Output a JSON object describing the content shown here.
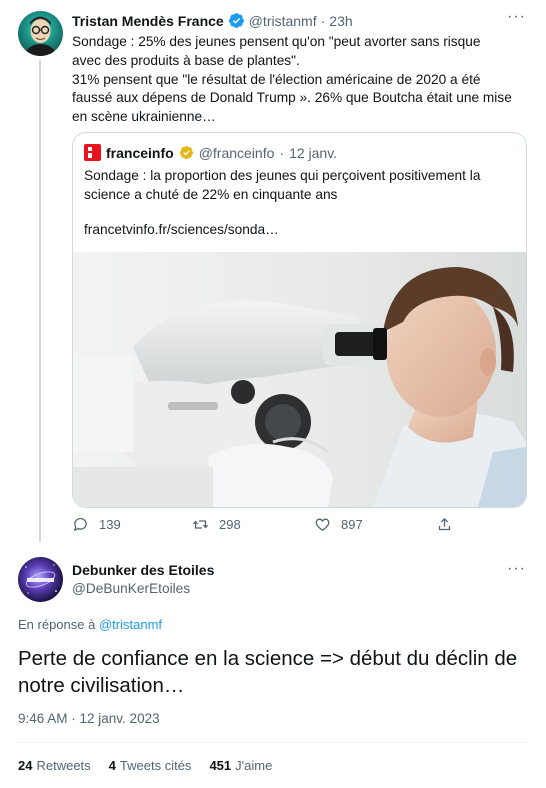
{
  "tweet": {
    "author_name": "Tristan Mendès France",
    "author_handle": "@tristanmf",
    "sep": "·",
    "time": "23h",
    "text_line1": "Sondage : 25% des jeunes pensent qu'on \"peut avorter sans risque avec des produits à base de plantes\".",
    "text_line2": "31% pensent que \"le résultat de l'élection américaine de 2020 a été faussé aux dépens de Donald Trump ». 26% que Boutcha était une mise en scène ukrainienne…",
    "quote": {
      "name": "franceinfo",
      "handle": "@franceinfo",
      "sep": "·",
      "date": "12 janv.",
      "text": "Sondage : la proportion des jeunes qui perçoivent positivement la science a chuté de 22% en cinquante ans",
      "link": "francetvinfo.fr/sciences/sonda…"
    },
    "actions": {
      "replies": "139",
      "retweets": "298",
      "likes": "897"
    }
  },
  "reply": {
    "author_name": "Debunker des Etoiles",
    "author_handle": "@DeBunKerEtoiles",
    "reply_prefix": "En réponse à",
    "reply_target": "@tristanmf",
    "text": "Perte de confiance en la science => début du déclin de notre civilisation…",
    "timestamp": "9:46 AM · 12 janv. 2023",
    "stats": {
      "retweets_count": "24",
      "retweets_label": "Retweets",
      "quotes_count": "4",
      "quotes_label": "Tweets cités",
      "likes_count": "451",
      "likes_label": "J'aime"
    }
  },
  "colors": {
    "accent": "#1d9bf0",
    "muted": "#536471",
    "text": "#0f1419",
    "border": "#cfd9de",
    "brand_franceinfo": "#e8131d"
  }
}
